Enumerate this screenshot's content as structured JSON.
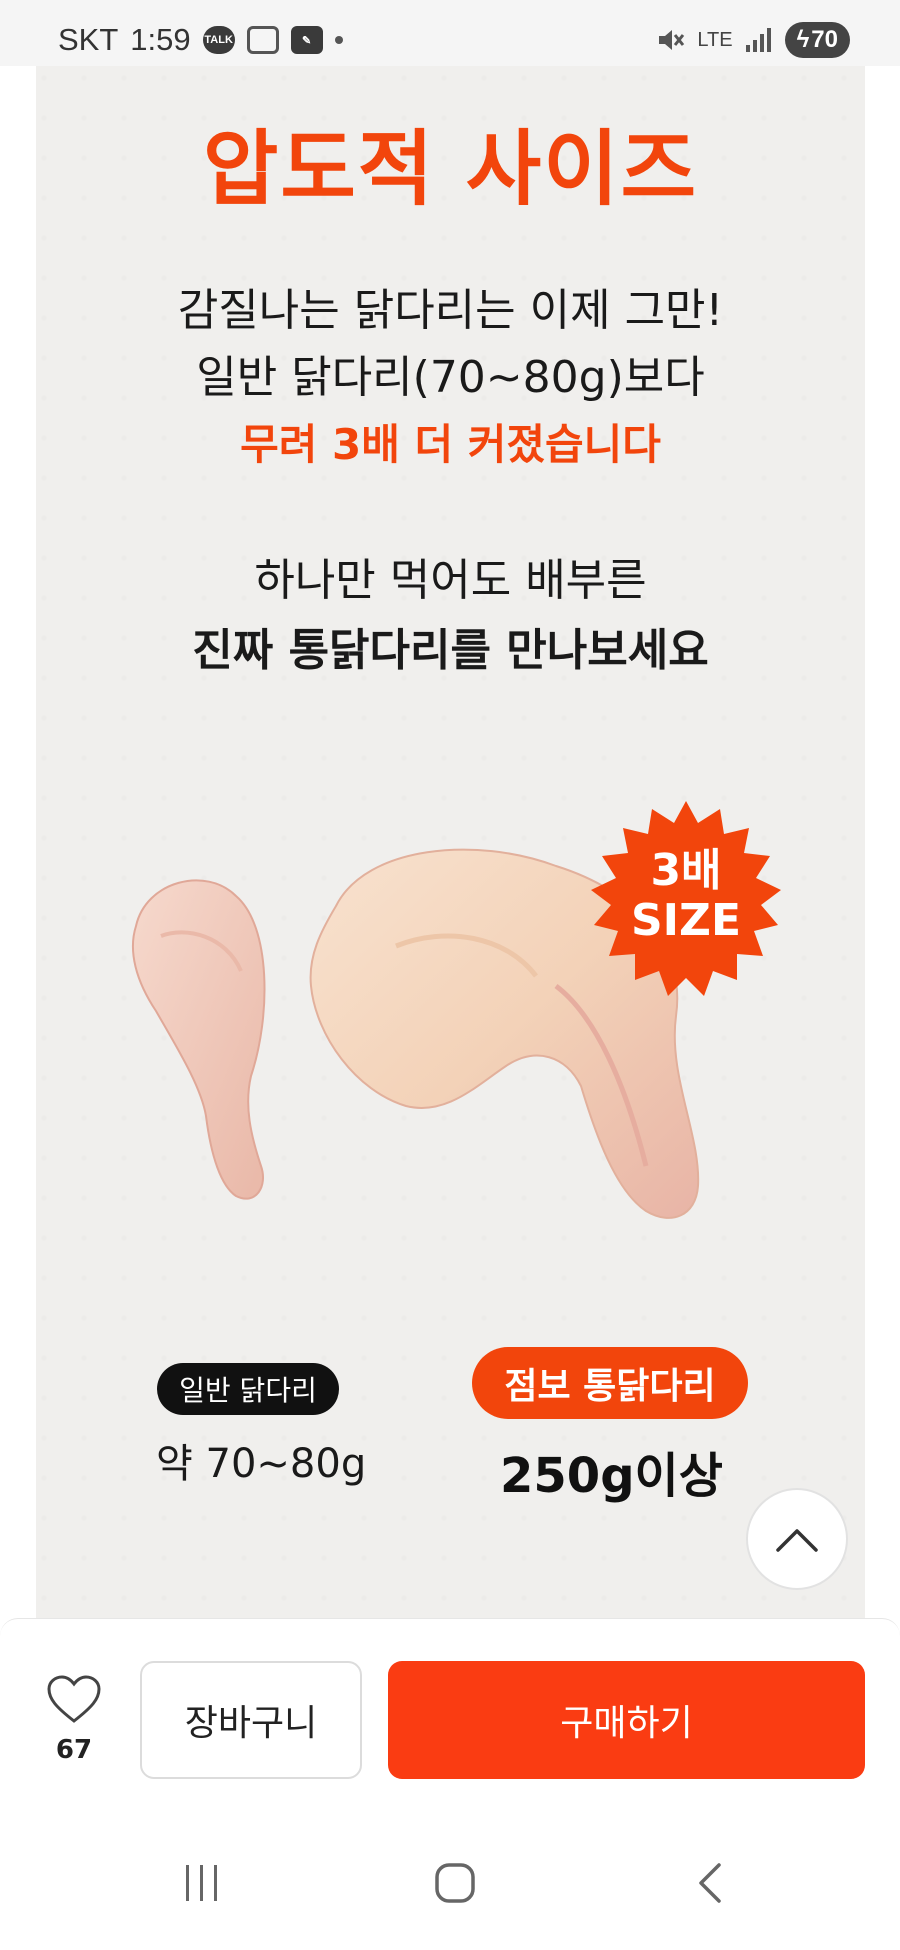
{
  "status": {
    "carrier": "SKT",
    "time": "1:59",
    "battery": "70",
    "network": "LTE"
  },
  "content": {
    "cut_heading": "",
    "title": "압도적 사이즈",
    "line1": "감질나는 닭다리는 이제 그만!",
    "line2": "일반 닭다리(70~80g)보다",
    "line3": "무려 3배 더 커졌습니다",
    "line4": "하나만 먹어도 배부른",
    "line5": "진짜 통닭다리를 만나보세요",
    "badge_line1": "3배",
    "badge_line2": "SIZE",
    "normal_label": "일반 닭다리",
    "normal_weight": "약 70~80g",
    "jumbo_label": "점보 통닭다리",
    "jumbo_weight": "250g이상"
  },
  "action_bar": {
    "like_count": "67",
    "cart_label": "장바구니",
    "buy_label": "구매하기"
  },
  "colors": {
    "accent": "#f2450c",
    "buy_button": "#fa3c12",
    "background": "#f0efed"
  }
}
